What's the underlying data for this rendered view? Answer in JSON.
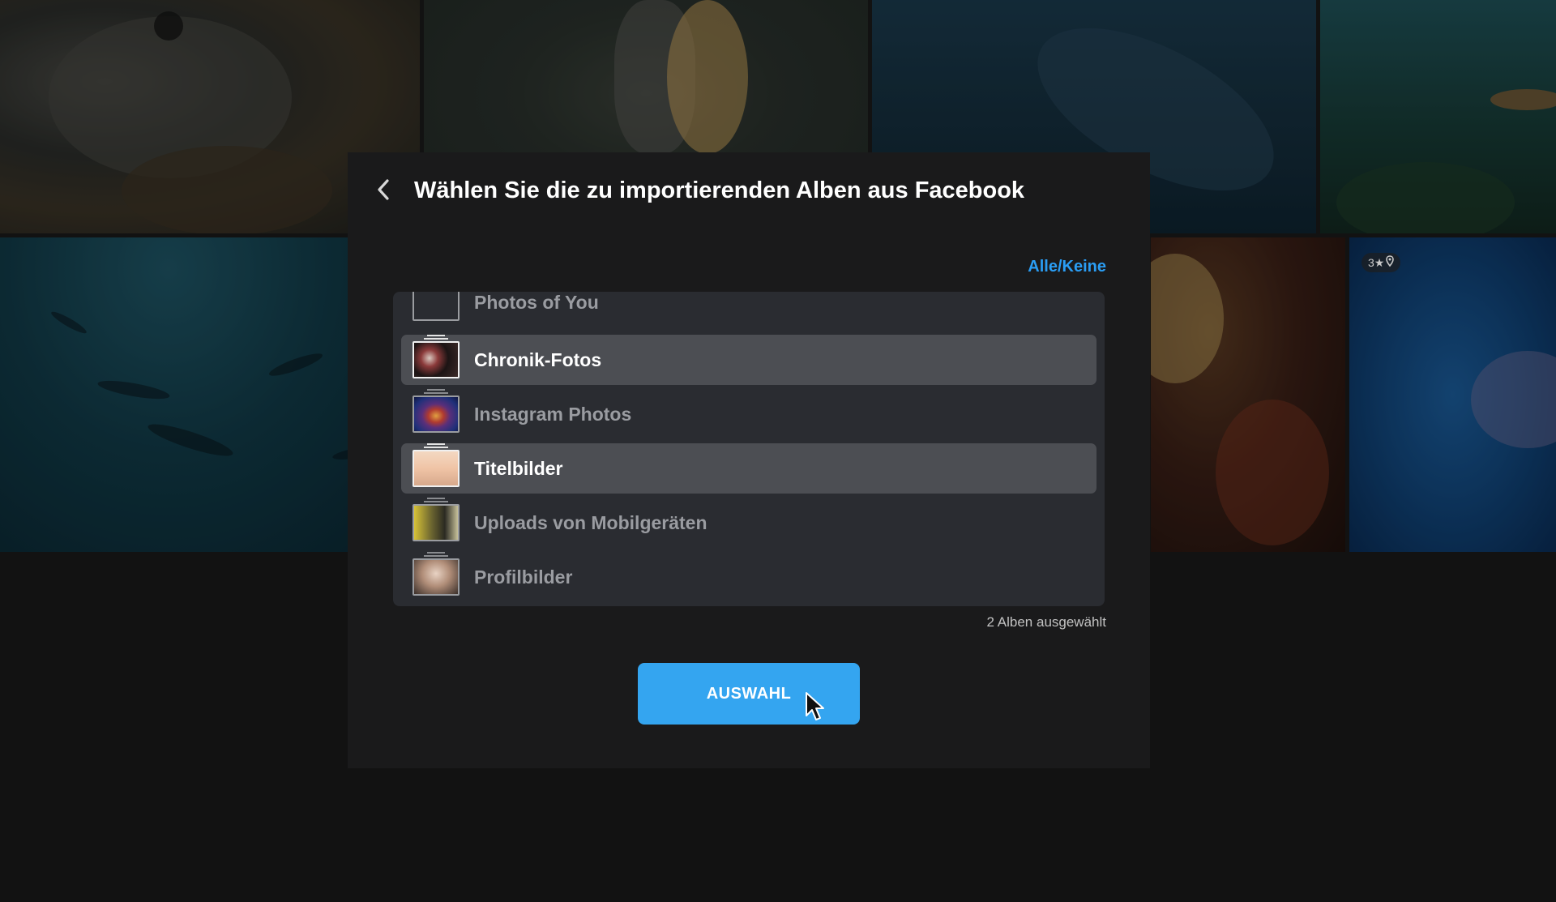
{
  "dialog": {
    "title": "Wählen Sie die zu importierenden Alben aus Facebook",
    "back_icon": "chevron-left-icon",
    "all_none_label": "Alle/Keine",
    "albums": [
      {
        "label": "Photos of You",
        "selected": false,
        "thumb": "th-empty"
      },
      {
        "label": "Chronik-Fotos",
        "selected": true,
        "thumb": "th-chronik"
      },
      {
        "label": "Instagram Photos",
        "selected": false,
        "thumb": "th-insta"
      },
      {
        "label": "Titelbilder",
        "selected": true,
        "thumb": "th-titel"
      },
      {
        "label": "Uploads von Mobilgeräten",
        "selected": false,
        "thumb": "th-uploads"
      },
      {
        "label": "Profilbilder",
        "selected": false,
        "thumb": "th-profil"
      }
    ],
    "selected_count_text": "2 Alben ausgewählt",
    "select_button_label": "AUSWAHL"
  },
  "background": {
    "badge_text": "3★",
    "badge_icon": "location-pin-icon"
  },
  "colors": {
    "accent": "#34a5f0",
    "link": "#2a9df4",
    "dialog_bg": "#1a1a1b",
    "list_bg": "#2a2c31",
    "row_selected_bg": "#4c4e53"
  }
}
